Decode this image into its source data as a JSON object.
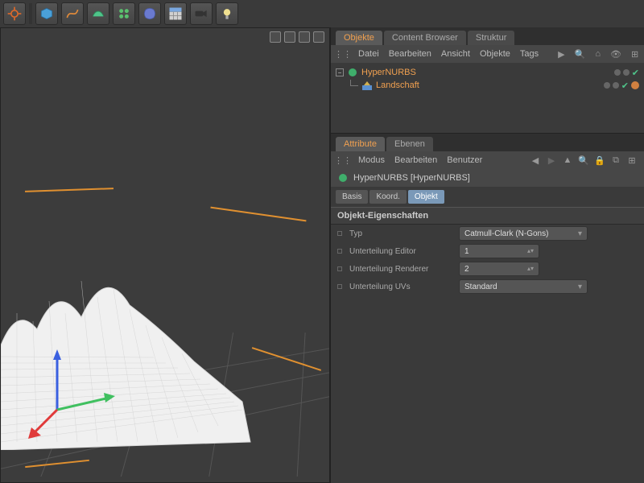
{
  "toolbar_icons": [
    "gear-icon",
    "cube-icon",
    "spline-icon",
    "nurbs-icon",
    "array-icon",
    "deformer-icon",
    "floor-icon",
    "camera-icon",
    "light-icon"
  ],
  "side": {
    "top_tabs": [
      {
        "label": "Objekte",
        "active": true
      },
      {
        "label": "Content Browser",
        "active": false
      },
      {
        "label": "Struktur",
        "active": false
      }
    ],
    "obj_menu": [
      "Datei",
      "Bearbeiten",
      "Ansicht",
      "Objekte",
      "Tags"
    ],
    "tree": [
      {
        "name": "HyperNURBS",
        "icon": "hypernurbs-icon",
        "level": 0,
        "expand": "-",
        "tags": [
          "dot",
          "dot",
          "check"
        ]
      },
      {
        "name": "Landschaft",
        "icon": "landscape-icon",
        "level": 1,
        "expand": "",
        "tags": [
          "dot",
          "dot",
          "check",
          "tag-dot"
        ]
      }
    ],
    "attr_tabs": [
      {
        "label": "Attribute",
        "active": true
      },
      {
        "label": "Ebenen",
        "active": false
      }
    ],
    "attr_menu": [
      "Modus",
      "Bearbeiten",
      "Benutzer"
    ],
    "attr_head_name": "HyperNURBS [HyperNURBS]",
    "attr_subtabs": [
      {
        "label": "Basis",
        "active": false
      },
      {
        "label": "Koord.",
        "active": false
      },
      {
        "label": "Objekt",
        "active": true
      }
    ],
    "attr_section": "Objekt-Eigenschaften",
    "props": [
      {
        "label": "Typ",
        "kind": "drop",
        "value": "Catmull-Clark (N-Gons)"
      },
      {
        "label": "Unterteilung Editor",
        "kind": "spin",
        "value": "1"
      },
      {
        "label": "Unterteilung Renderer",
        "kind": "spin",
        "value": "2"
      },
      {
        "label": "Unterteilung UVs",
        "kind": "drop",
        "value": "Standard"
      }
    ]
  }
}
